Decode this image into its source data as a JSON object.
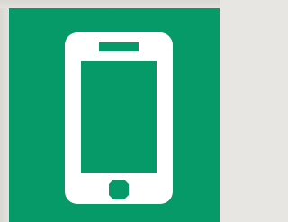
{
  "icon": {
    "name": "smartphone-icon",
    "tile_color": "#079a69",
    "icon_color": "#ffffff",
    "background_color": "#e3e1dd"
  }
}
